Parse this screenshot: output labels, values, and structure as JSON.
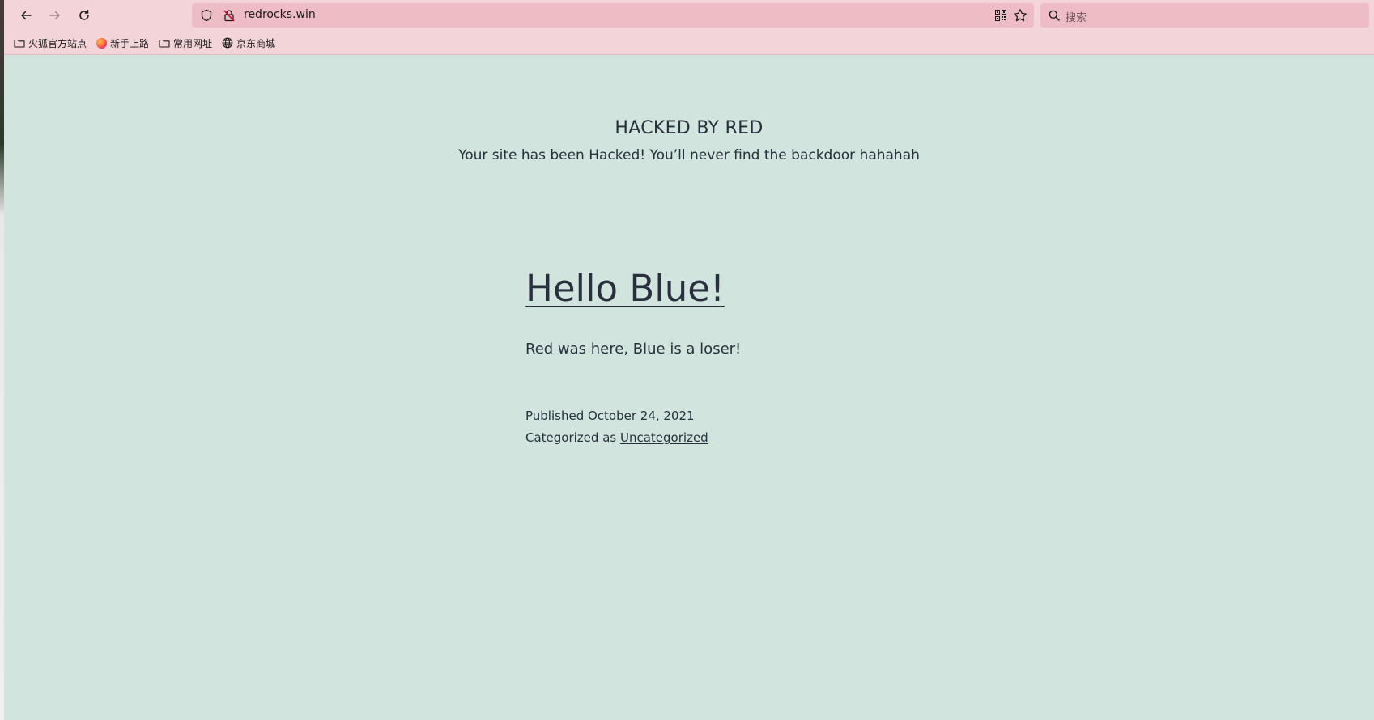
{
  "browser": {
    "url": "redrocks.win",
    "search_placeholder": "搜索",
    "bookmarks": [
      {
        "label": "火狐官方站点",
        "icon": "folder-icon"
      },
      {
        "label": "新手上路",
        "icon": "firefox-icon"
      },
      {
        "label": "常用网址",
        "icon": "folder-icon"
      },
      {
        "label": "京东商城",
        "icon": "globe-icon"
      }
    ],
    "colors": {
      "toolbar": "#f2d4d9",
      "urlbar": "#eebcc4",
      "page_background": "#d1e4dd",
      "text": "#28303d"
    }
  },
  "site": {
    "title": "HACKED BY RED",
    "description": "Your site has been Hacked! You’ll never find the backdoor hahahah"
  },
  "post": {
    "title": "Hello Blue!",
    "body": "Red was here, Blue is a loser!",
    "published_label": "Published",
    "published_date": "October 24, 2021",
    "category_label": "Categorized as",
    "category": "Uncategorized"
  }
}
